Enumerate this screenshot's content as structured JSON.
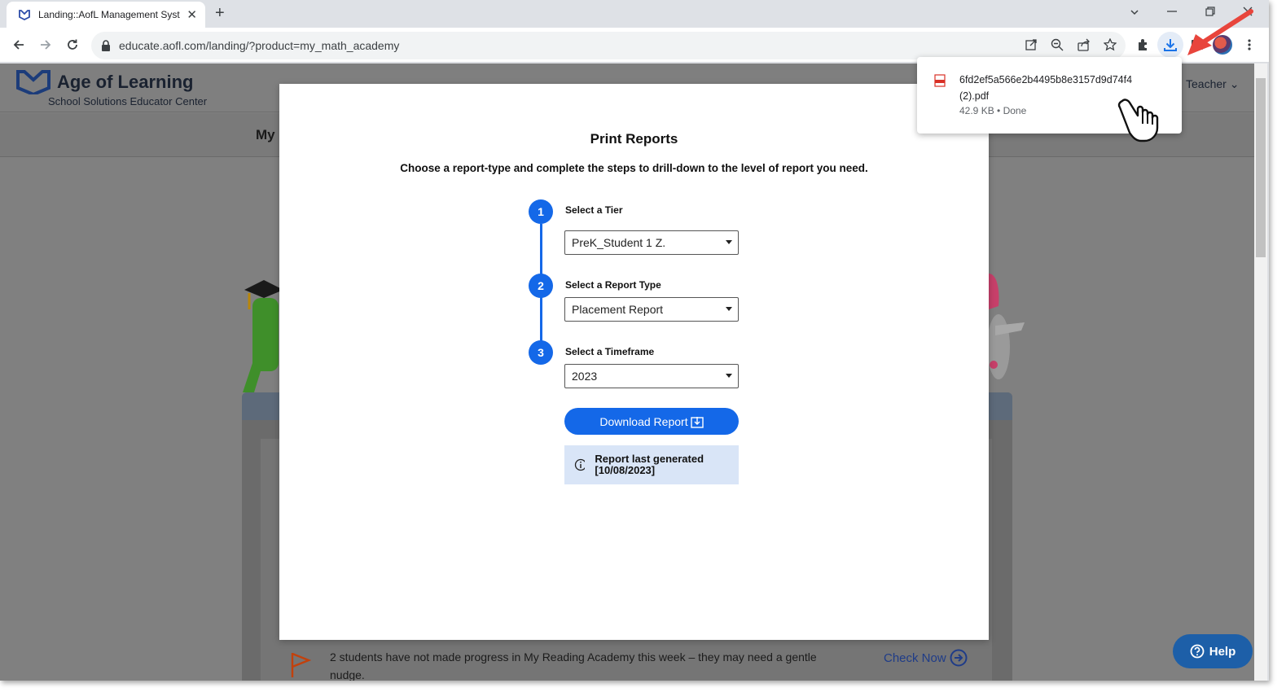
{
  "browser": {
    "tab_title": "Landing::AofL Management Syst",
    "url": "educate.aofl.com/landing/?product=my_math_academy"
  },
  "site": {
    "brand": "Age of Learning",
    "subtitle": "School Solutions Educator Center",
    "user_menu": "Teacher",
    "nav_partial": "My"
  },
  "modal": {
    "title": "Print Reports",
    "subtitle": "Choose a report-type and complete the steps to drill-down to the level of report you need.",
    "steps": [
      {
        "number": "1",
        "label": "Select a Tier",
        "value": "PreK_Student 1 Z."
      },
      {
        "number": "2",
        "label": "Select a Report Type",
        "value": "Placement Report"
      },
      {
        "number": "3",
        "label": "Select a Timeframe",
        "value": "2023"
      }
    ],
    "download_label": "Download Report",
    "last_generated": "Report last generated [10/08/2023]"
  },
  "download_popup": {
    "filename": "6fd2ef5a566e2b4495b8e3157d9d74f4 (2).pdf",
    "meta": "42.9 KB • Done"
  },
  "banner": {
    "message": "2 students have not made progress in My Reading Academy this week – they may need a gentle nudge.",
    "link": "Check Now"
  },
  "help": {
    "label": "Help"
  },
  "colors": {
    "primary": "#1468e8",
    "help": "#1d5fa8",
    "overlay": "#808080",
    "arrow": "#e8453c"
  }
}
